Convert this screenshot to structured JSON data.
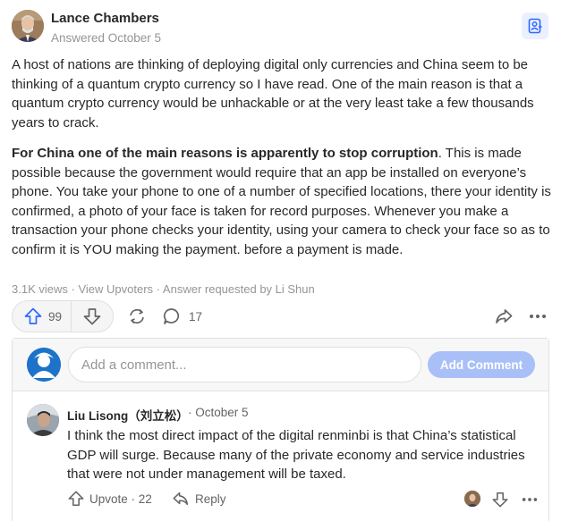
{
  "answer": {
    "author_name": "Lance Chambers",
    "answered_label": "Answered October 5",
    "paragraph1": "A host of nations are thinking of deploying digital only currencies and China seem to be thinking of a quantum crypto currency so I have read. One of the main reason is that a quantum crypto currency would be unhackable or at the very least take a few thousands years to crack.",
    "paragraph2_bold": "For China one of the main reasons is apparently to stop corruption",
    "paragraph2_rest": ". This is made possible because the government would require that an app be installed on everyone’s phone. You take your phone to one of a number of specified locations, there your identity is confirmed, a photo of your face is taken for record purposes. Whenever you make a transaction your phone checks your identity, using your camera to check your face so as to confirm it is YOU making the payment. before a payment is made.",
    "views": "3.1K views",
    "view_upvoters": "View Upvoters",
    "request": "Answer requested by Li Shun",
    "separator": "·"
  },
  "actions": {
    "upvote_count": "99",
    "comment_count": "17"
  },
  "composer": {
    "placeholder": "Add a comment...",
    "submit_label": "Add Comment"
  },
  "comment": {
    "author": "Liu Lisong（刘立松）",
    "date": "· October 5",
    "text": "I think the most direct impact of the digital renminbi is that China’s statistical GDP will surge. Because many of the private economy and service industries that were not under management will be taxed.",
    "upvote_label": "Upvote · 22",
    "reply_label": "Reply"
  },
  "colors": {
    "accent": "#2e69ff",
    "accent_light": "#a9bff7",
    "muted": "#939598",
    "text": "#282829"
  },
  "icons": {
    "save": "bookmark-user-icon",
    "upvote": "arrow-up-icon",
    "downvote": "arrow-down-icon",
    "share": "reshare-icon",
    "comment": "speech-bubble-icon",
    "forward": "forward-share-icon",
    "more": "ellipsis-icon",
    "reply": "reply-arrow-icon"
  }
}
